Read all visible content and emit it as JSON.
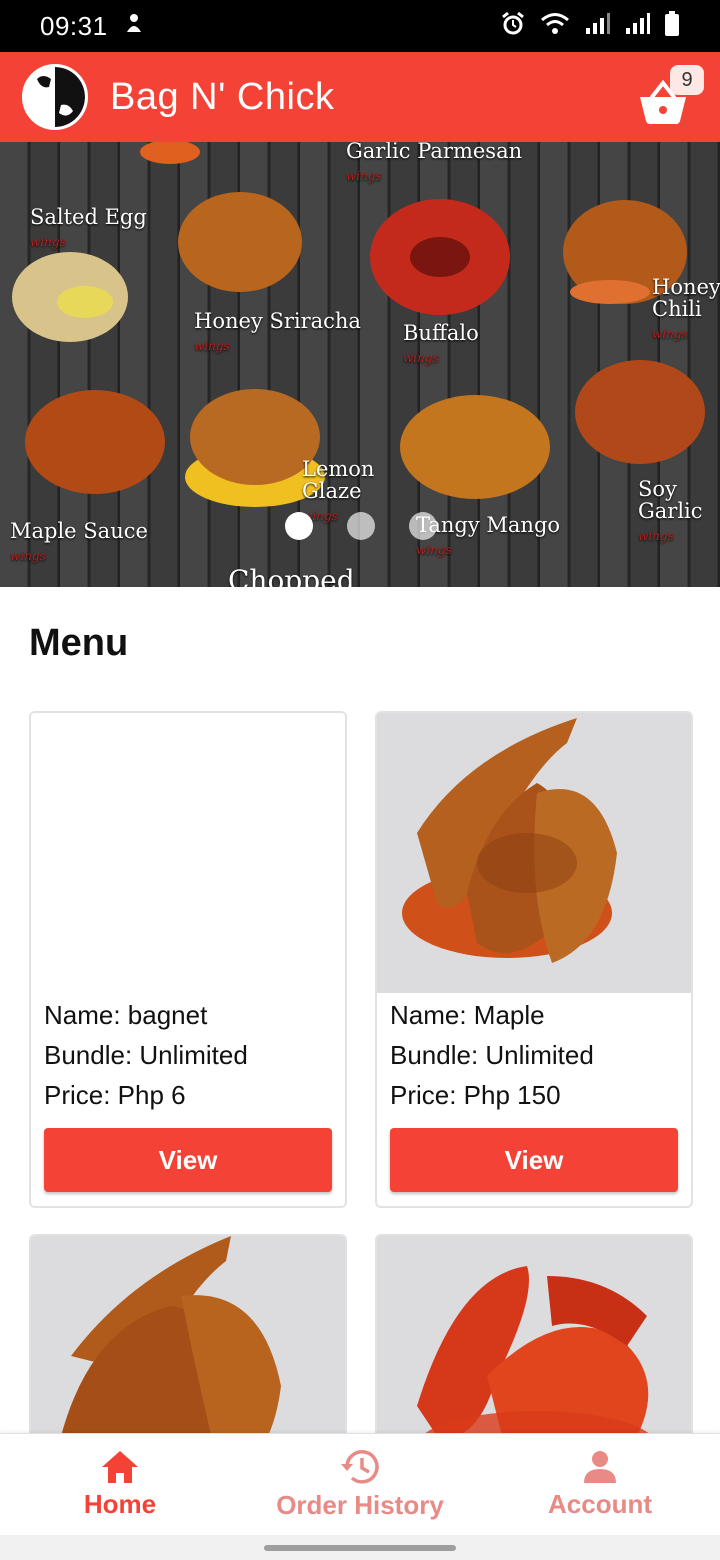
{
  "status_bar": {
    "time": "09:31"
  },
  "app_bar": {
    "title": "Bag N' Chick",
    "logo_text": "Bag N' Chick",
    "cart_count": "9"
  },
  "banner": {
    "labels": [
      {
        "name": "Salted Egg",
        "sub": "wings"
      },
      {
        "name": "Garlic Parmesan",
        "sub": "wings"
      },
      {
        "name": "Honey Sriracha",
        "sub": "wings"
      },
      {
        "name": "Buffalo",
        "sub": "wings"
      },
      {
        "name": "Honey Chili",
        "sub": "wings"
      },
      {
        "name": "Lemon Glaze",
        "sub": "wings"
      },
      {
        "name": "Maple Sauce",
        "sub": "wings"
      },
      {
        "name": "Tangy Mango",
        "sub": "wings"
      },
      {
        "name": "Soy Garlic",
        "sub": "wings"
      },
      {
        "name": "Chopped",
        "sub": ""
      }
    ],
    "active_slide": 1,
    "slide_count": 3
  },
  "menu": {
    "title": "Menu",
    "items": [
      {
        "name": "Name: bagnet",
        "bundle": "Bundle: Unlimited",
        "price": "Price: Php 6",
        "button": "View"
      },
      {
        "name": "Name: Maple",
        "bundle": "Bundle: Unlimited",
        "price": "Price: Php 150",
        "button": "View"
      }
    ]
  },
  "bottom_nav": {
    "items": [
      {
        "label": "Home",
        "icon": "home-icon",
        "active": true
      },
      {
        "label": "Order History",
        "icon": "history-icon",
        "active": false
      },
      {
        "label": "Account",
        "icon": "account-icon",
        "active": false
      }
    ]
  },
  "colors": {
    "primary": "#f44336",
    "inactive_nav": "#e88a85"
  }
}
